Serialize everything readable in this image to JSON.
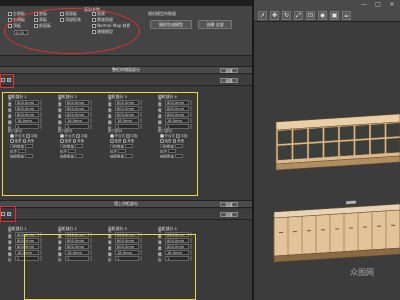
{
  "top": {
    "group_title": "基础参数",
    "checkboxes": [
      "左侧板",
      "右侧板",
      "顶板",
      "底板",
      "背板",
      "前面板",
      "背面板",
      "顶部柜体"
    ],
    "value": "0.00",
    "opt_a": "创建",
    "opt_b": "厚度保留",
    "opt_c": "Normal Map 材质",
    "opt_d": "建模模型",
    "link_label": "随机模型的数量",
    "btn_random": "随机生成模型",
    "btn_create_all": "创建 全部"
  },
  "section1": {
    "title": "整柜的储面部分",
    "right_btn": "创建",
    "columns": [
      {
        "head": "地柜部分 1",
        "w": "800.0mm",
        "h": "800.0mm",
        "d": "800.0mm",
        "t": "18.0mm",
        "n": "1"
      },
      {
        "head": "地柜部分 2",
        "w": "800.0mm",
        "h": "800.0mm",
        "d": "800.0mm",
        "t": "18.0mm",
        "n": "1"
      },
      {
        "head": "地柜部分 3",
        "w": "800.0mm",
        "h": "800.0mm",
        "d": "800.0mm",
        "t": "18.0mm",
        "n": "1"
      },
      {
        "head": "地柜部分 4",
        "w": "800.0mm",
        "h": "800.0mm",
        "d": "800.0mm",
        "t": "18.0mm",
        "n": "1"
      }
    ],
    "field_labels": {
      "w": "宽度",
      "h": "高度",
      "d": "深度",
      "t": "厚度",
      "n": "隔板"
    },
    "door_head": "柜门部分",
    "door_opts": [
      "开合式",
      "平板",
      "抽屉",
      "其他"
    ],
    "door_count_label": "门的数量",
    "handle_label": "拉手",
    "layer_label": "抽屉数量"
  },
  "section2": {
    "title": "墙上吊柜部分",
    "right_btn": "创建",
    "columns": [
      {
        "head": "吊柜部分 1",
        "w": "800.0mm",
        "h": "800.0mm",
        "d": "800.0mm",
        "t": "18.0mm",
        "n": "1"
      },
      {
        "head": "吊柜部分 2",
        "w": "800.0mm",
        "h": "800.0mm",
        "d": "800.0mm",
        "t": "18.0mm",
        "n": "1"
      },
      {
        "head": "吊柜部分 3",
        "w": "800.0mm",
        "h": "800.0mm",
        "d": "800.0mm",
        "t": "18.0mm",
        "n": "1"
      },
      {
        "head": "吊柜部分 4",
        "w": "800.0mm",
        "h": "800.0mm",
        "d": "800.0mm",
        "t": "18.0mm",
        "n": "1"
      }
    ]
  },
  "viewport": {
    "toolbar_icons": [
      "select-icon",
      "move-icon",
      "rotate-icon",
      "scale-icon",
      "snap-icon",
      "render-icon",
      "render-frame-icon",
      "teapot-icon"
    ],
    "win_controls": [
      "—",
      "□",
      "✕"
    ],
    "watermark": "众图网"
  },
  "colors": {
    "annotation_red": "#e03030",
    "annotation_yellow": "#e8d84a",
    "wood": "#e2c39a",
    "panel": "#3a3a3a"
  }
}
